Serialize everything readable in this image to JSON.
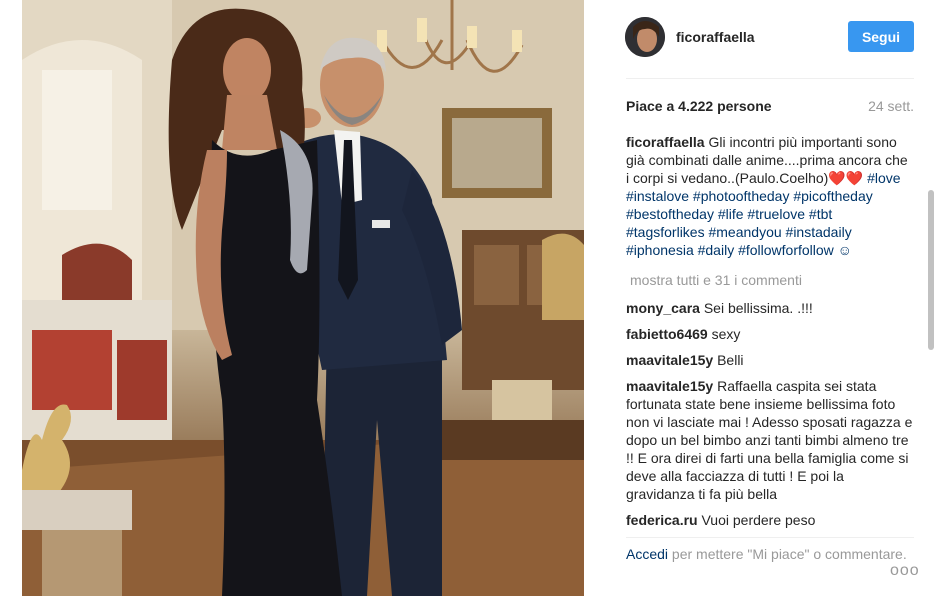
{
  "post": {
    "username": "ficoraffaella",
    "follow_label": "Segui",
    "likes_text": "Piace a 4.222 persone",
    "time_ago": "24 sett.",
    "caption": {
      "user": "ficoraffaella",
      "text": "Gli incontri più importanti sono già combinati dalle anime....prima ancora che i corpi si vedano..(Paulo.Coelho)❤️❤️",
      "hashtags": "#love #instalove #photooftheday #picoftheday #bestoftheday #life #truelove #tbt #tagsforlikes #meandyou #instadaily #iphonesia #daily #followforfollow ☺"
    },
    "load_more": "mostra tutti e 31 i commenti",
    "comments": [
      {
        "user": "mony_cara",
        "text": "Sei bellissima. .!!!"
      },
      {
        "user": "fabietto6469",
        "text": "sexy"
      },
      {
        "user": "maavitale15y",
        "text": "Belli"
      },
      {
        "user": "maavitale15y",
        "text": "Raffaella caspita sei stata fortunata state bene insieme bellissima foto non vi lasciate mai ! Adesso sposati ragazza e dopo un bel bimbo anzi tanti bimbi almeno tre !! E ora direi di farti una bella famiglia come si deve alla facciazza di tutti ! E poi la gravidanza ti fa più bella"
      },
      {
        "user": "federica.ru",
        "text": "Vuoi perdere peso"
      }
    ],
    "footer": {
      "login": "Accedi",
      "rest": "per mettere \"Mi piace\" o commentare."
    },
    "more_icon": "ooo"
  },
  "colors": {
    "accent": "#3897f0",
    "link": "#003569",
    "muted": "#999999"
  }
}
